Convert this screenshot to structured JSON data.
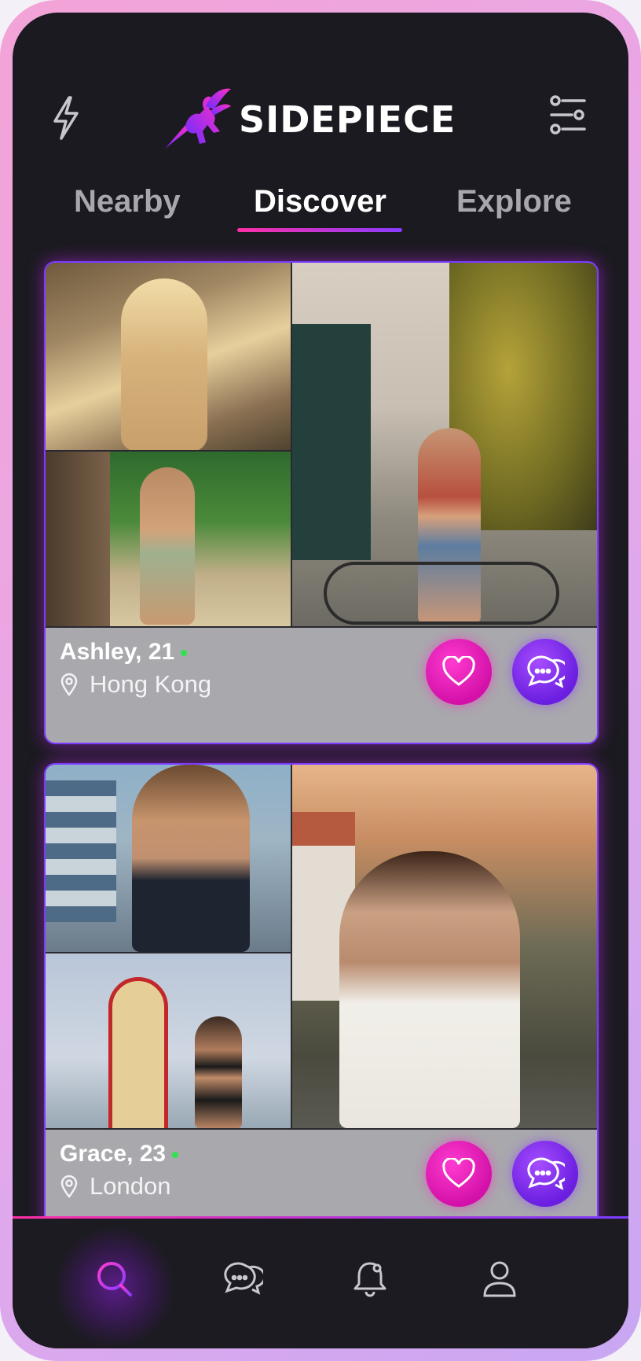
{
  "app": {
    "brand": "SIDEPIECE"
  },
  "header": {
    "left_icon": "lightning-icon",
    "right_icon": "filter-sliders-icon"
  },
  "tabs": [
    {
      "label": "Nearby",
      "active": false
    },
    {
      "label": "Discover",
      "active": true
    },
    {
      "label": "Explore",
      "active": false
    }
  ],
  "profiles": [
    {
      "name_age": "Ashley, 21",
      "online": true,
      "location": "Hong Kong"
    },
    {
      "name_age": "Grace, 23",
      "online": true,
      "location": "London"
    }
  ],
  "bottom_nav": [
    {
      "icon": "search-icon",
      "active": true
    },
    {
      "icon": "chat-icon",
      "active": false
    },
    {
      "icon": "notification-bell-icon",
      "active": false
    },
    {
      "icon": "profile-icon",
      "active": false
    }
  ],
  "colors": {
    "accent_pink": "#ff2fa7",
    "accent_purple": "#7b3cff",
    "background": "#1b1a20",
    "online": "#2fe34e"
  }
}
